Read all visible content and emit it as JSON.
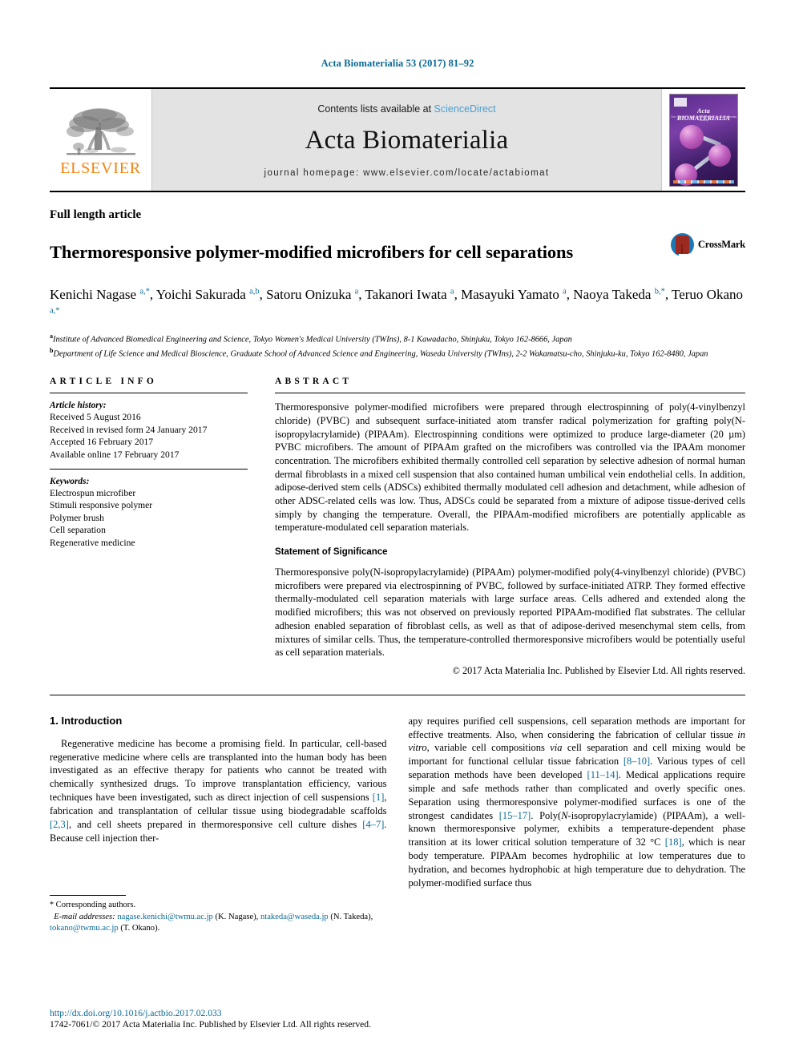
{
  "running_head": "Acta Biomaterialia 53 (2017) 81–92",
  "masthead": {
    "publisher_logo_text": "ELSEVIER",
    "contents_prefix": "Contents lists available at ",
    "contents_link": "ScienceDirect",
    "journal_title": "Acta Biomaterialia",
    "homepage_label": "journal homepage: www.elsevier.com/locate/actabiomat",
    "cover": {
      "title": "Acta BIOMATERIALIA",
      "subtitle": "The Journal of The Acta Materialia Inc. Biomaterials Society"
    }
  },
  "article": {
    "type": "Full length article",
    "title": "Thermoresponsive polymer-modified microfibers for cell separations",
    "crossmark_label": "CrossMark",
    "authors_html": "Kenichi Nagase <sup>a,*</sup>, Yoichi Sakurada <sup>a,b</sup>, Satoru Onizuka <sup>a</sup>, Takanori Iwata <sup>a</sup>, Masayuki Yamato <sup>a</sup>, Naoya Takeda <sup>b,*</sup>, Teruo Okano <sup>a,*</sup>",
    "affiliation_a": "Institute of Advanced Biomedical Engineering and Science, Tokyo Women's Medical University (TWIns), 8-1 Kawadacho, Shinjuku, Tokyo 162-8666, Japan",
    "affiliation_b": "Department of Life Science and Medical Bioscience, Graduate School of Advanced Science and Engineering, Waseda University (TWIns), 2-2 Wakamatsu-cho, Shinjuku-ku, Tokyo 162-8480, Japan"
  },
  "article_info": {
    "heading": "ARTICLE INFO",
    "history_label": "Article history:",
    "history": [
      "Received 5 August 2016",
      "Received in revised form 24 January 2017",
      "Accepted 16 February 2017",
      "Available online 17 February 2017"
    ],
    "keywords_label": "Keywords:",
    "keywords": [
      "Electrospun microfiber",
      "Stimuli responsive polymer",
      "Polymer brush",
      "Cell separation",
      "Regenerative medicine"
    ]
  },
  "abstract": {
    "heading": "ABSTRACT",
    "body": "Thermoresponsive polymer-modified microfibers were prepared through electrospinning of poly(4-vinylbenzyl chloride) (PVBC) and subsequent surface-initiated atom transfer radical polymerization for grafting poly(N-isopropylacrylamide) (PIPAAm). Electrospinning conditions were optimized to produce large-diameter (20 µm) PVBC microfibers. The amount of PIPAAm grafted on the microfibers was controlled via the IPAAm monomer concentration. The microfibers exhibited thermally controlled cell separation by selective adhesion of normal human dermal fibroblasts in a mixed cell suspension that also contained human umbilical vein endothelial cells. In addition, adipose-derived stem cells (ADSCs) exhibited thermally modulated cell adhesion and detachment, while adhesion of other ADSC-related cells was low. Thus, ADSCs could be separated from a mixture of adipose tissue-derived cells simply by changing the temperature. Overall, the PIPAAm-modified microfibers are potentially applicable as temperature-modulated cell separation materials.",
    "significance_heading": "Statement of Significance",
    "significance_body": "Thermoresponsive poly(N-isopropylacrylamide) (PIPAAm) polymer-modified poly(4-vinylbenzyl chloride) (PVBC) microfibers were prepared via electrospinning of PVBC, followed by surface-initiated ATRP. They formed effective thermally-modulated cell separation materials with large surface areas. Cells adhered and extended along the modified microfibers; this was not observed on previously reported PIPAAm-modified flat substrates. The cellular adhesion enabled separation of fibroblast cells, as well as that of adipose-derived mesenchymal stem cells, from mixtures of similar cells. Thus, the temperature-controlled thermoresponsive microfibers would be potentially useful as cell separation materials.",
    "copyright": "© 2017 Acta Materialia Inc. Published by Elsevier Ltd. All rights reserved."
  },
  "introduction": {
    "heading": "1. Introduction",
    "col_left_html": "Regenerative medicine has become a promising field. In particular, cell-based regenerative medicine where cells are transplanted into the human body has been investigated as an effective therapy for patients who cannot be treated with chemically synthesized drugs. To improve transplantation efficiency, various techniques have been investigated, such as direct injection of cell suspensions <span class=\"ref\">[1]</span>, fabrication and transplantation of cellular tissue using biodegradable scaffolds <span class=\"ref\">[2,3]</span>, and cell sheets prepared in thermoresponsive cell culture dishes <span class=\"ref\">[4–7]</span>. Because cell injection ther-",
    "col_right_html": "apy requires purified cell suspensions, cell separation methods are important for effective treatments. Also, when considering the fabrication of cellular tissue <i>in vitro</i>, variable cell compositions <i>via</i> cell separation and cell mixing would be important for functional cellular tissue fabrication <span class=\"ref\">[8–10]</span>. Various types of cell separation methods have been developed <span class=\"ref\">[11–14]</span>. Medical applications require simple and safe methods rather than complicated and overly specific ones. Separation using thermoresponsive polymer-modified surfaces is one of the strongest candidates <span class=\"ref\">[15–17]</span>. Poly(<i>N</i>-isopropylacrylamide) (PIPAAm), a well-known thermoresponsive polymer, exhibits a temperature-dependent phase transition at its lower critical solution temperature of 32 °C <span class=\"ref\">[18]</span>, which is near body temperature. PIPAAm becomes hydrophilic at low temperatures due to hydration, and becomes hydrophobic at high temperature due to dehydration. The polymer-modified surface thus"
  },
  "footnote": {
    "star": "*",
    "corresponding": "Corresponding authors.",
    "email_label": "E-mail addresses:",
    "emails_html": "<span class=\"ref\">nagase.kenichi@twmu.ac.jp</span> (K. Nagase), <span class=\"ref\">ntakeda@waseda.jp</span> (N. Takeda), <span class=\"ref\">tokano@twmu.ac.jp</span> (T. Okano)."
  },
  "page_footer": {
    "doi": "http://dx.doi.org/10.1016/j.actbio.2017.02.033",
    "issn_line": "1742-7061/© 2017 Acta Materialia Inc. Published by Elsevier Ltd. All rights reserved."
  },
  "colors": {
    "link_blue": "#0b6a96",
    "sciencedirect_blue": "#4a9fd4",
    "elsevier_orange": "#f5820b",
    "banner_gray": "#e3e3e3",
    "crossmark_red": "#9c2a21",
    "crossmark_blue": "#1d77b5"
  }
}
